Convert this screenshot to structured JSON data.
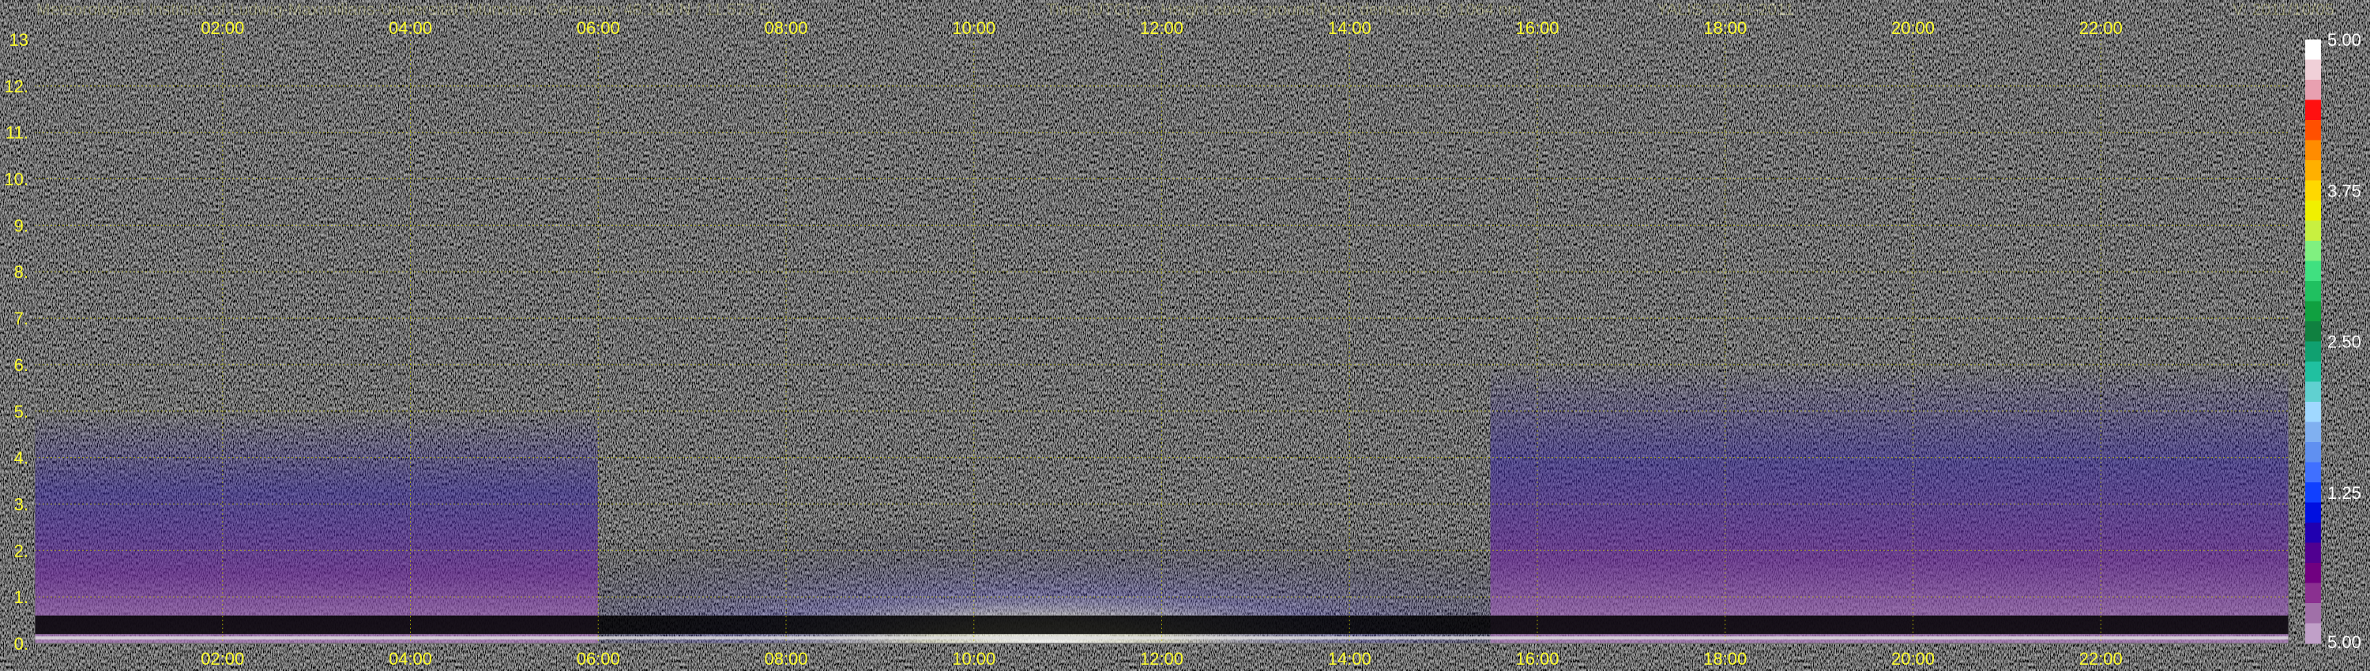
{
  "header": {
    "institute": "Meteorological Institute of Ludwig-Maximilians-Universität (München, Germany; 48.148 N / 11.573 E):",
    "axes_desc": "Time [UTC] vs. Height above ground [km]: derivative @ 1064 nm",
    "instrument_date": "YALIS: 02-11-2011",
    "version": "V: 2011/10/05"
  },
  "colors": {
    "text": "#ffff2e",
    "grid": "#c8c800",
    "background": "#000000"
  },
  "chart_data": {
    "type": "heatmap",
    "x_ticks": [
      "02:00",
      "04:00",
      "06:00",
      "08:00",
      "10:00",
      "12:00",
      "14:00",
      "16:00",
      "18:00",
      "20:00",
      "22:00"
    ],
    "x_range_hours": [
      0,
      24
    ],
    "y_ticks": [
      "0.",
      "1.",
      "2.",
      "3.",
      "4.",
      "5.",
      "6.",
      "7.",
      "8.",
      "9.",
      "10.",
      "11.",
      "12.",
      "13"
    ],
    "y_range_km": [
      0,
      13
    ],
    "grid": true,
    "colorbar": {
      "labels": [
        "5.00",
        "3.75",
        "2.50",
        "1.25",
        "5.00"
      ],
      "colors": [
        "#ffffff",
        "#f0d0d8",
        "#e8a0b0",
        "#ff1010",
        "#ff5000",
        "#ff8c00",
        "#ffb000",
        "#ffd800",
        "#f0f000",
        "#c8f040",
        "#80f080",
        "#40e080",
        "#20c060",
        "#10a040",
        "#108040",
        "#10a070",
        "#20c0a0",
        "#60d0d0",
        "#a0d8ff",
        "#80b0f0",
        "#6090f0",
        "#4070ff",
        "#1040ff",
        "#0010e0",
        "#2000b0",
        "#500090",
        "#700080",
        "#8a3090",
        "#a070a8",
        "#c0a0c8"
      ]
    }
  }
}
